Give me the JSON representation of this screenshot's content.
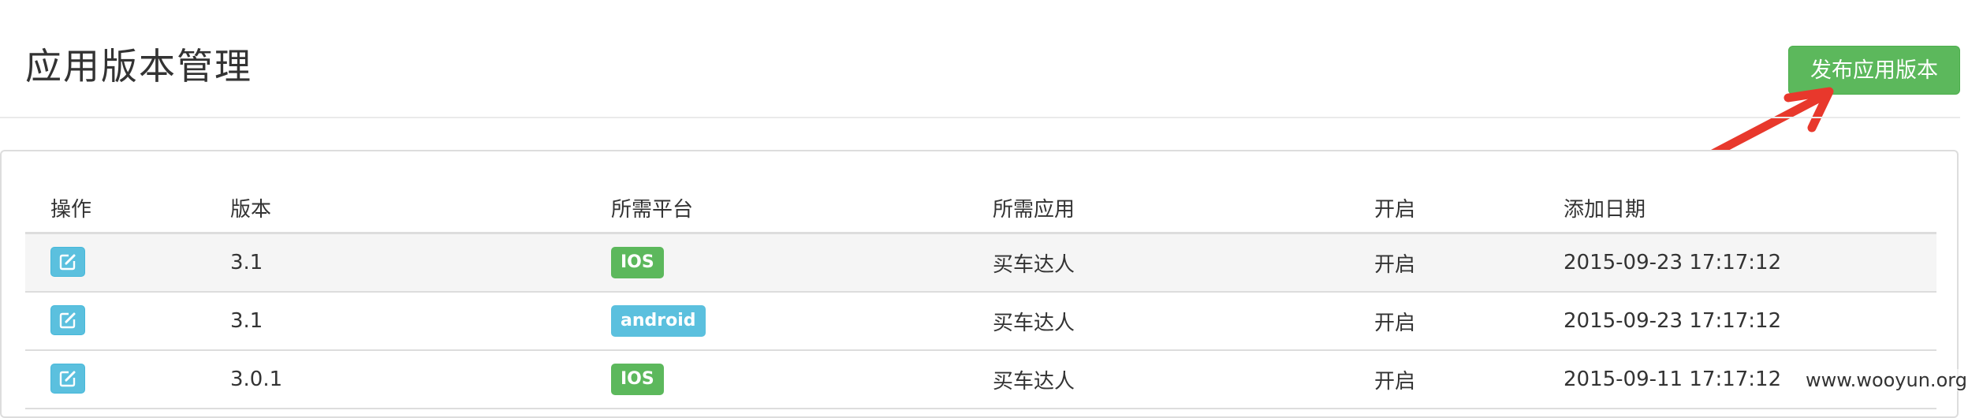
{
  "page": {
    "title": "应用版本管理",
    "publish_button": "发布应用版本"
  },
  "table": {
    "headers": [
      "操作",
      "版本",
      "所需平台",
      "所需应用",
      "开启",
      "添加日期"
    ],
    "rows": [
      {
        "version": "3.1",
        "platform": "IOS",
        "platform_color": "#5cb85c",
        "app": "买车达人",
        "enabled": "开启",
        "date": "2015-09-23 17:17:12"
      },
      {
        "version": "3.1",
        "platform": "android",
        "platform_color": "#5bc0de",
        "app": "买车达人",
        "enabled": "开启",
        "date": "2015-09-23 17:17:12"
      },
      {
        "version": "3.0.1",
        "platform": "IOS",
        "platform_color": "#5cb85c",
        "app": "买车达人",
        "enabled": "开启",
        "date": "2015-09-11 17:17:12"
      }
    ]
  },
  "watermark": "www.wooyun.org",
  "colors": {
    "success": "#5cb85c",
    "info": "#5bc0de",
    "annotation_arrow": "#e8382c"
  }
}
